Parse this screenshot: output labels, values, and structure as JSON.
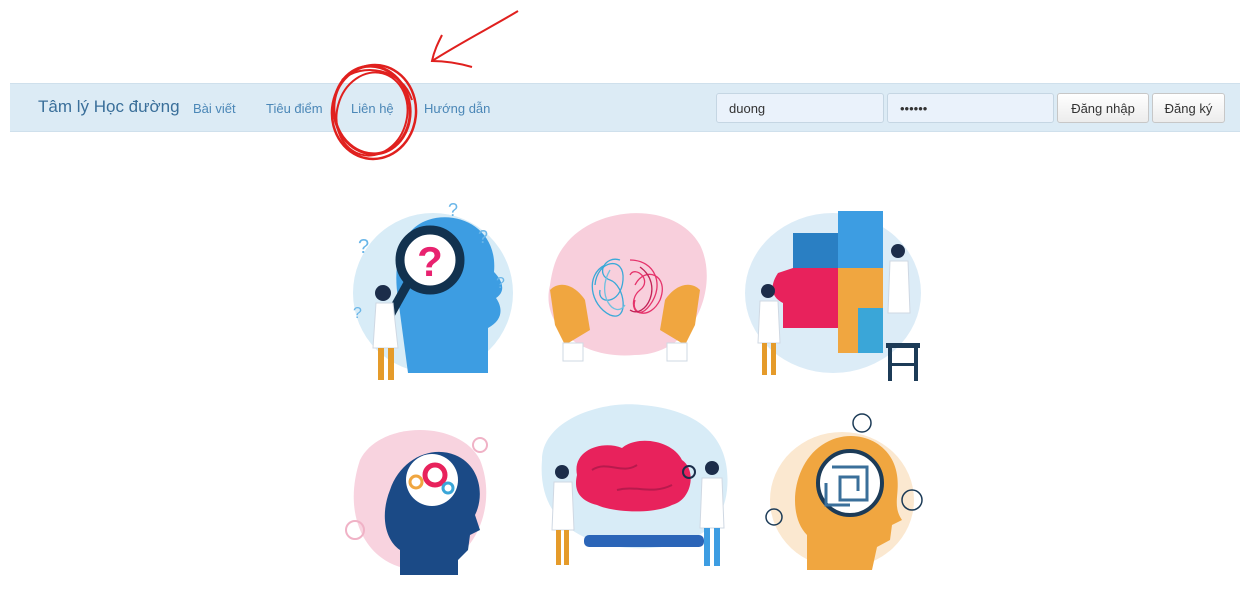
{
  "navbar": {
    "brand": "Tâm lý Học đường",
    "links": [
      "Bài viết",
      "Tiêu điểm",
      "Liên hệ",
      "Hướng dẫn"
    ],
    "username_value": "duong",
    "password_value": "••••••",
    "login_label": "Đăng nhập",
    "register_label": "Đăng ký"
  },
  "illustrations": [
    {
      "name": "magnifier-head",
      "symbol": "?"
    },
    {
      "name": "tangled-brain"
    },
    {
      "name": "puzzle-head"
    },
    {
      "name": "gears-head"
    },
    {
      "name": "brain-research"
    },
    {
      "name": "maze-head"
    }
  ],
  "colors": {
    "navbar_bg": "#dcebf5",
    "brand": "#3a6f9a",
    "link": "#4b87b7",
    "annotation": "#e0201e"
  }
}
